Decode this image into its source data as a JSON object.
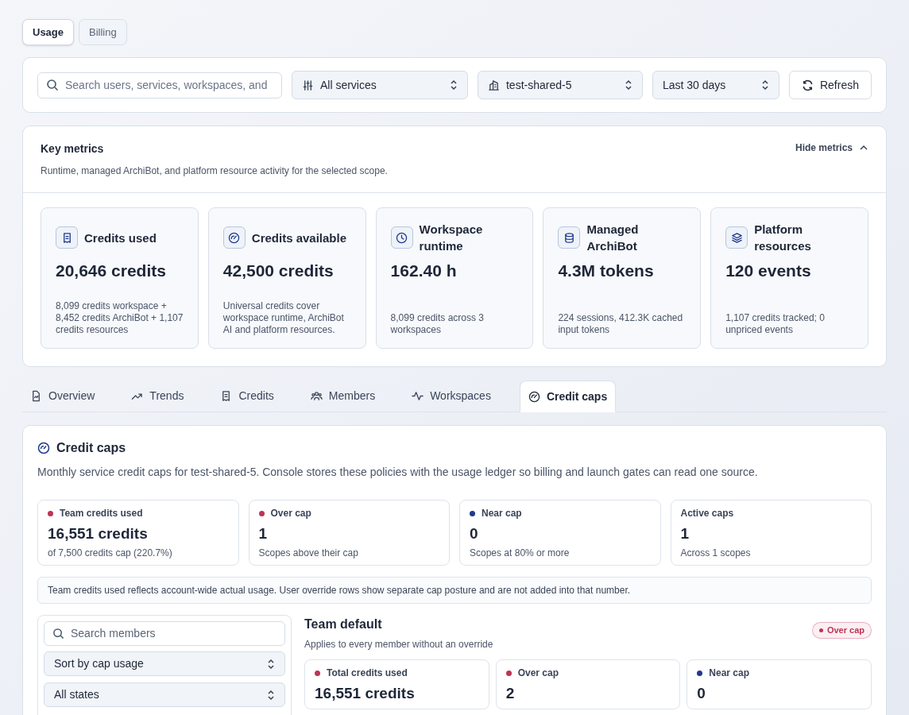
{
  "top_tabs": [
    {
      "label": "Usage",
      "selected": true
    },
    {
      "label": "Billing",
      "selected": false
    }
  ],
  "toolbar": {
    "search": {
      "placeholder": "Search users, services, workspaces, and"
    },
    "selects": [
      {
        "kind": "sliders",
        "value": "All services"
      },
      {
        "kind": "building",
        "value": "test-shared-5"
      },
      {
        "kind": "plain",
        "value": "Last 30 days"
      }
    ],
    "refresh": "Refresh"
  },
  "key_metrics": {
    "title": "Key metrics",
    "subtitle": "Runtime, managed ArchiBot, and platform resource activity for the selected scope.",
    "toggle": {
      "label": "Hide metrics",
      "expanded": true
    },
    "cards": [
      {
        "kind": "receipt",
        "title": "Credits used",
        "value": "20,646 credits",
        "note": "8,099 credits workspace + 8,452 credits ArchiBot + 1,107 credits resources"
      },
      {
        "kind": "gauge",
        "title": "Credits available",
        "value": "42,500 credits",
        "note": "Universal credits cover workspace runtime, ArchiBot AI and platform resources."
      },
      {
        "kind": "clock",
        "title": "Workspace runtime",
        "value": "162.40 h",
        "note": "8,099 credits across 3 workspaces"
      },
      {
        "kind": "database",
        "title": "Managed ArchiBot",
        "value": "4.3M tokens",
        "note": "224 sessions, 412.3K cached input tokens"
      },
      {
        "kind": "layers",
        "title": "Platform resources",
        "value": "120 events",
        "note": "1,107 credits tracked; 0 unpriced events"
      }
    ]
  },
  "section_tabs": [
    {
      "kind": "file",
      "label": "Overview",
      "selected": false
    },
    {
      "kind": "trend",
      "label": "Trends",
      "selected": false
    },
    {
      "kind": "receipt",
      "label": "Credits",
      "selected": false
    },
    {
      "kind": "users",
      "label": "Members",
      "selected": false
    },
    {
      "kind": "pulse",
      "label": "Workspaces",
      "selected": false
    },
    {
      "kind": "gauge",
      "label": "Credit caps",
      "selected": true
    }
  ],
  "credit_caps": {
    "title": "Credit caps",
    "description": "Monthly service credit caps for test-shared-5. Console stores these policies with the usage ledger so billing and launch gates can read one source.",
    "stats": [
      {
        "label": "Team credits used",
        "color": "#be3455",
        "value": "16,551 credits",
        "note": "of 7,500 credits cap (220.7%)"
      },
      {
        "label": "Over cap",
        "color": "#be3455",
        "value": "1",
        "note": "Scopes above their cap"
      },
      {
        "label": "Near cap",
        "color": "#1e3a8a",
        "value": "0",
        "note": "Scopes at 80% or more"
      },
      {
        "label": "Active caps",
        "value": "1",
        "note": "Across 1 scopes"
      }
    ],
    "notice": "Team credits used reflects account-wide actual usage. User override rows show separate cap posture and are not added into that number.",
    "members": {
      "search": {
        "placeholder": "Search members"
      },
      "selects": [
        "Sort by cap usage",
        "All states"
      ]
    },
    "team_default": {
      "title": "Team default",
      "subtitle": "Applies to every member without an override",
      "badge": {
        "label": "Over cap",
        "color": "#be3455"
      },
      "stats": [
        {
          "label": "Total credits used",
          "color": "#be3455",
          "value": "16,551 credits"
        },
        {
          "label": "Over cap",
          "color": "#be3455",
          "value": "2"
        },
        {
          "label": "Near cap",
          "color": "#1e3a8a",
          "value": "0"
        }
      ]
    }
  }
}
